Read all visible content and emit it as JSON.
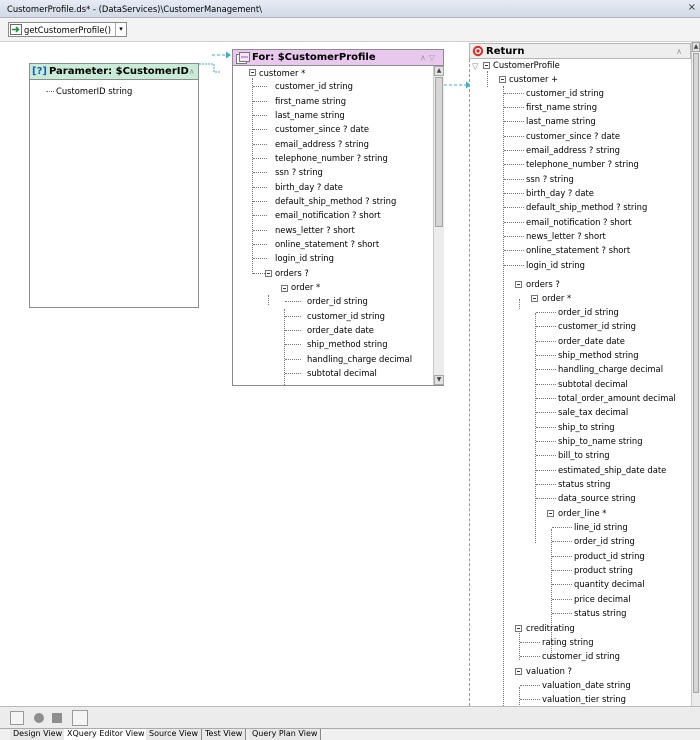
{
  "window": {
    "title": "CustomerProfile.ds* - (DataServices)\\CustomerManagement\\",
    "close_glyph": "×"
  },
  "toolbar": {
    "function_label": "getCustomerProfile()",
    "dropdown_glyph": "▾"
  },
  "param_panel": {
    "icon": "[?]",
    "title": "Parameter: $CustomerID",
    "nodes": [
      "CustomerID string"
    ]
  },
  "for_panel": {
    "title": "For: $CustomerProfile",
    "nodes": [
      "customer *",
      "customer_id string",
      "first_name string",
      "last_name string",
      "customer_since ? date",
      "email_address ? string",
      "telephone_number ? string",
      "ssn ? string",
      "birth_day ? date",
      "default_ship_method ? string",
      "email_notification ? short",
      "news_letter ? short",
      "online_statement ? short",
      "login_id string",
      "orders ?",
      "order *",
      "order_id string",
      "customer_id string",
      "order_date date",
      "ship_method string",
      "handling_charge decimal",
      "subtotal decimal"
    ]
  },
  "return_panel": {
    "title": "Return",
    "nodes": [
      "CustomerProfile",
      "customer +",
      "customer_id string",
      "first_name string",
      "last_name string",
      "customer_since ? date",
      "email_address ? string",
      "telephone_number ? string",
      "ssn ? string",
      "birth_day ? date",
      "default_ship_method ? string",
      "email_notification ? short",
      "news_letter ? short",
      "online_statement ? short",
      "login_id string",
      "orders ?",
      "order *",
      "order_id string",
      "customer_id string",
      "order_date date",
      "ship_method string",
      "handling_charge decimal",
      "subtotal decimal",
      "total_order_amount decimal",
      "sale_tax decimal",
      "ship_to string",
      "ship_to_name string",
      "bill_to string",
      "estimated_ship_date date",
      "status string",
      "data_source string",
      "order_line *",
      "line_id string",
      "order_id string",
      "product_id string",
      "product string",
      "quantity decimal",
      "price decimal",
      "status string",
      "creditrating",
      "rating string",
      "customer_id string",
      "valuation ?",
      "valuation_date string",
      "valuation_tier string"
    ]
  },
  "view_tabs": [
    "Design View",
    "XQuery Editor View",
    "Source View",
    "Test View",
    "Query Plan View"
  ],
  "colors": {
    "param_header": "#c9ecd8",
    "for_header": "#e9c8ee",
    "link_color": "#38b3c4",
    "return_icon": "#d9312b"
  }
}
